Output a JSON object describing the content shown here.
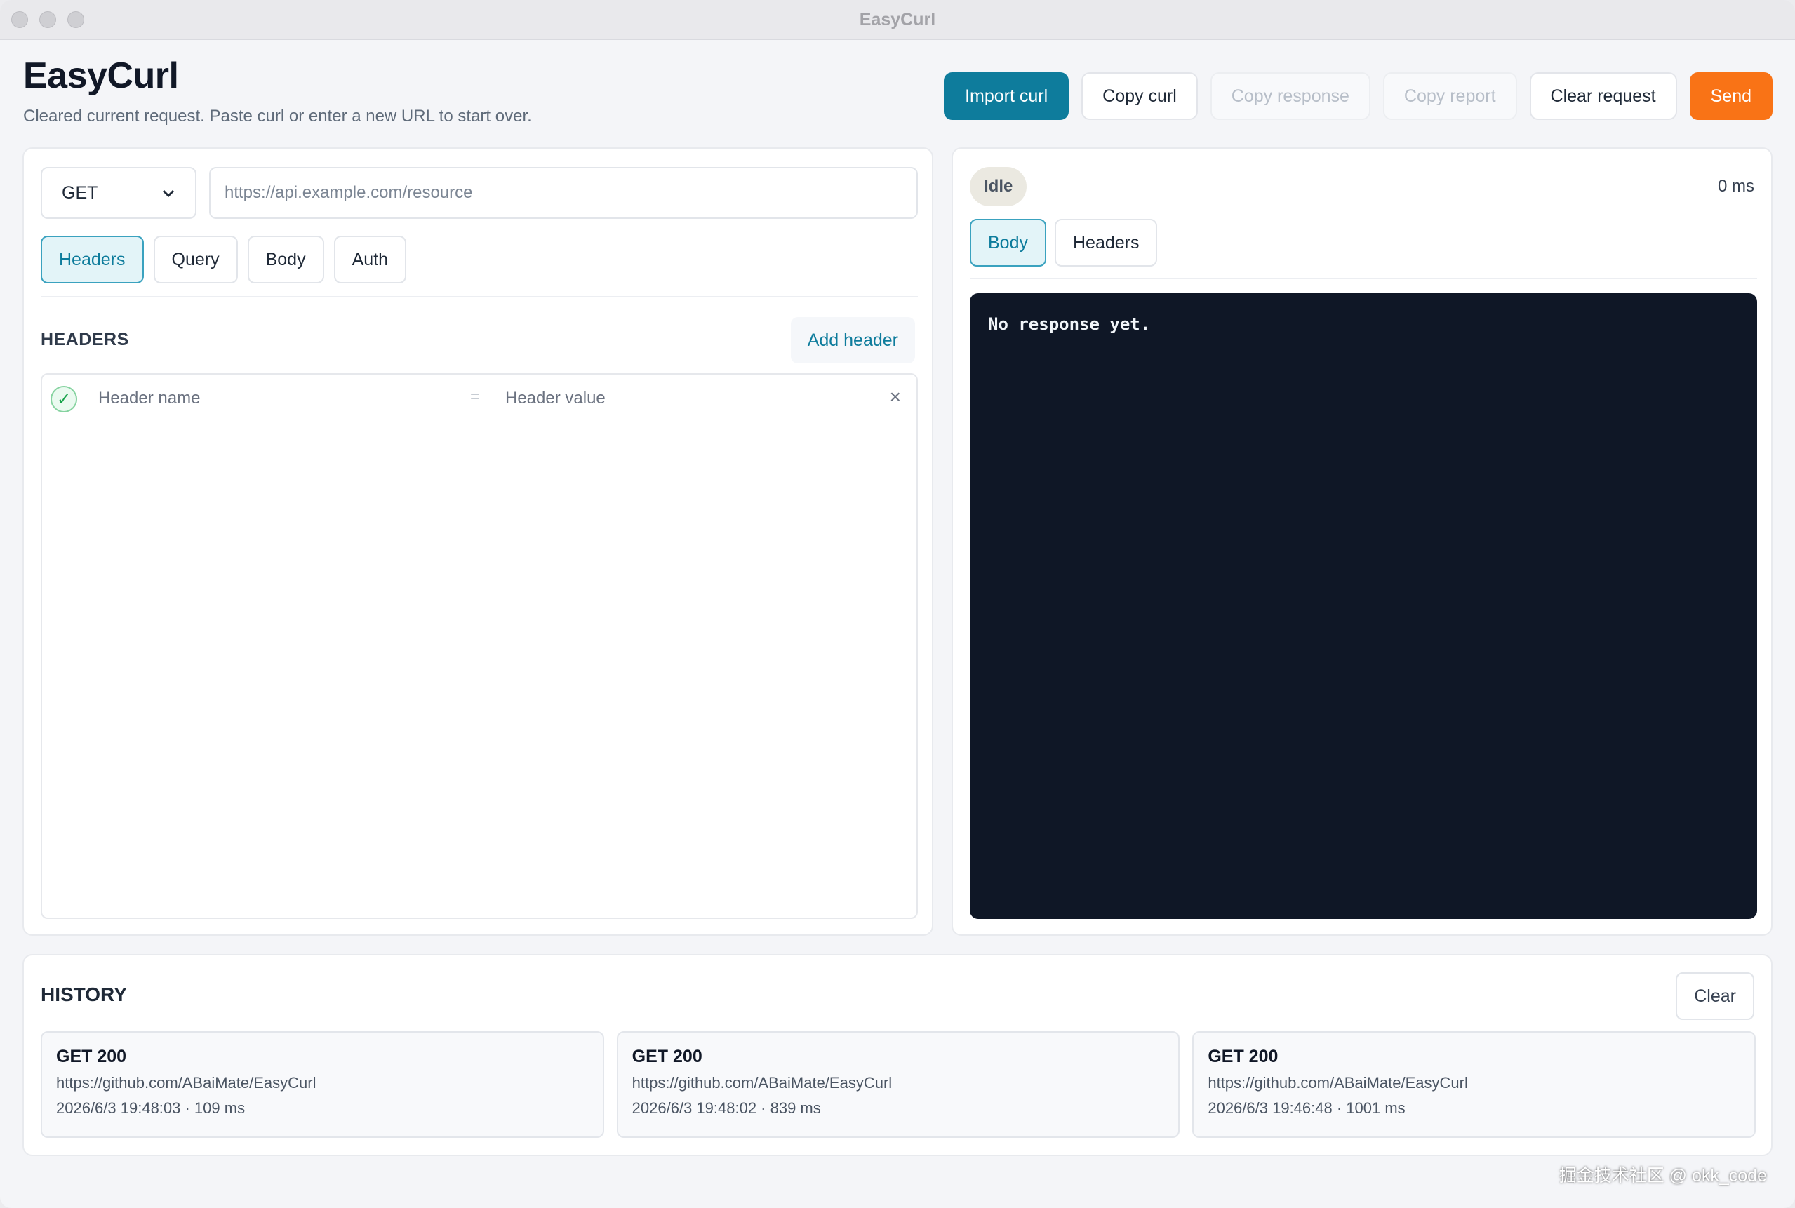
{
  "window": {
    "title": "EasyCurl"
  },
  "app": {
    "title": "EasyCurl",
    "status": "Cleared current request. Paste curl or enter a new URL to start over."
  },
  "toolbar": {
    "import_curl": "Import curl",
    "copy_curl": "Copy curl",
    "copy_response": "Copy response",
    "copy_report": "Copy report",
    "clear_request": "Clear request",
    "send": "Send"
  },
  "request": {
    "method": "GET",
    "method_options": [
      "GET"
    ],
    "url_placeholder": "https://api.example.com/resource",
    "url_value": "",
    "tabs": [
      {
        "label": "Headers",
        "active": true
      },
      {
        "label": "Query",
        "active": false
      },
      {
        "label": "Body",
        "active": false
      },
      {
        "label": "Auth",
        "active": false
      }
    ],
    "section_label": "HEADERS",
    "add_header": "Add header",
    "headers": [
      {
        "enabled": true,
        "name_placeholder": "Header name",
        "separator": "=",
        "value_placeholder": "Header value",
        "remove": "×"
      }
    ]
  },
  "response": {
    "status": "Idle",
    "elapsed": "0 ms",
    "tabs": [
      {
        "label": "Body",
        "active": true
      },
      {
        "label": "Headers",
        "active": false
      }
    ],
    "body_text": "No response yet."
  },
  "history": {
    "title": "HISTORY",
    "clear": "Clear",
    "items": [
      {
        "method_status": "GET 200",
        "url": "https://github.com/ABaiMate/EasyCurl",
        "meta": "2026/6/3 19:48:03 · 109 ms"
      },
      {
        "method_status": "GET 200",
        "url": "https://github.com/ABaiMate/EasyCurl",
        "meta": "2026/6/3 19:48:02 · 839 ms"
      },
      {
        "method_status": "GET 200",
        "url": "https://github.com/ABaiMate/EasyCurl",
        "meta": "2026/6/3 19:46:48 · 1001 ms"
      }
    ]
  },
  "watermark": "掘金技术社区 @ okk_code",
  "colors": {
    "accent": "#0e7c9c",
    "send": "#f97316",
    "response_bg": "#0f1726"
  }
}
